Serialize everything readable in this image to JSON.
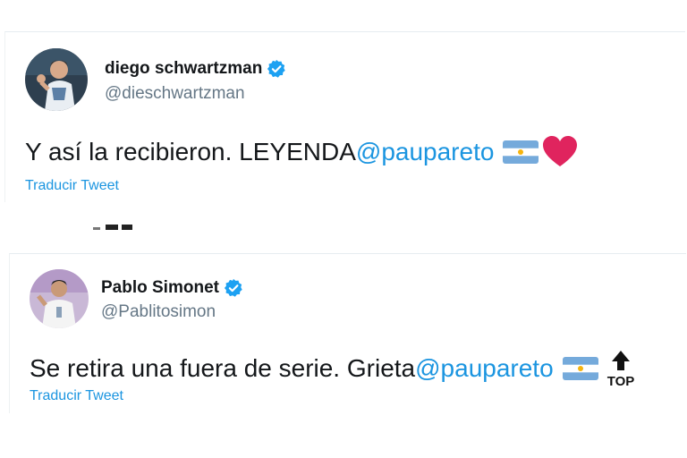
{
  "tweets": [
    {
      "display_name": "diego schwartzman",
      "handle": "@dieschwartzman",
      "text_before": "Y así la recibieron. LEYENDA",
      "mention": "@paupareto",
      "emojis": [
        "argentina-flag-icon",
        "red-heart-icon"
      ],
      "translate_label": "Traducir Tweet"
    },
    {
      "display_name": "Pablo Simonet",
      "handle": "@Pablitosimon",
      "text_before": "Se retira una fuera de serie. Grieta",
      "mention": "@paupareto",
      "emojis": [
        "argentina-flag-icon",
        "top-arrow-icon"
      ],
      "top_emoji_text": "TOP",
      "translate_label": "Traducir Tweet"
    }
  ],
  "colors": {
    "link": "#1b95e0",
    "verified": "#1da1f2",
    "handle": "#657786",
    "text": "#14171a",
    "heart": "#e0245e",
    "flag_blue": "#75aadb",
    "sun": "#f6b40e"
  }
}
